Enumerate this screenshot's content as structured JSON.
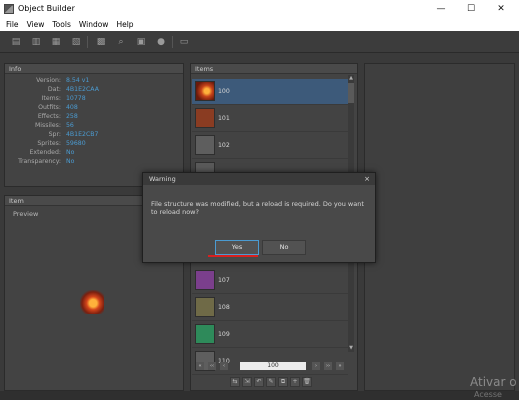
{
  "window": {
    "title": "Object Builder",
    "minimize": "—",
    "maximize": "☐",
    "close": "✕"
  },
  "menu": [
    "File",
    "View",
    "Tools",
    "Window",
    "Help"
  ],
  "toolbar": [
    "new-file-icon",
    "open-folder-icon",
    "save-icon",
    "save-as-icon",
    "compile-icon",
    "search-icon",
    "fit-icon",
    "play-icon",
    "log-icon"
  ],
  "info_panel": {
    "header": "Info",
    "rows": [
      {
        "label": "Version:",
        "value": "8.54 v1"
      },
      {
        "label": "Dat:",
        "value": "4B1E2CAA"
      },
      {
        "label": "Items:",
        "value": "10778"
      },
      {
        "label": "Outfits:",
        "value": "408"
      },
      {
        "label": "Effects:",
        "value": "258"
      },
      {
        "label": "Missiles:",
        "value": "56"
      },
      {
        "label": "Spr:",
        "value": "4B1E2CB7"
      },
      {
        "label": "Sprites:",
        "value": "59680"
      },
      {
        "label": "Extended:",
        "value": "No"
      },
      {
        "label": "Transparency:",
        "value": "No"
      }
    ]
  },
  "item_panel": {
    "header": "Item",
    "preview_label": "Preview"
  },
  "items_panel": {
    "header": "Items",
    "items": [
      {
        "id": "100",
        "color": "#9b3a1a",
        "selected": true
      },
      {
        "id": "101",
        "color": "#8a3c22"
      },
      {
        "id": "102",
        "color": "#6d6d6d"
      },
      {
        "id": "107",
        "color": "#7b3f8c"
      },
      {
        "id": "108",
        "color": "#6f6a47"
      },
      {
        "id": "109",
        "color": "#2e8a5a"
      },
      {
        "id": "110",
        "color": "#5e5e5e"
      }
    ],
    "page_value": "100"
  },
  "dialog": {
    "title": "Warning",
    "close": "×",
    "message": "File structure was modified, but a reload is required. Do you want to reload now?",
    "yes": "Yes",
    "no": "No"
  },
  "watermark": {
    "line1": "Ativar o",
    "line2": "Acesse Con"
  }
}
